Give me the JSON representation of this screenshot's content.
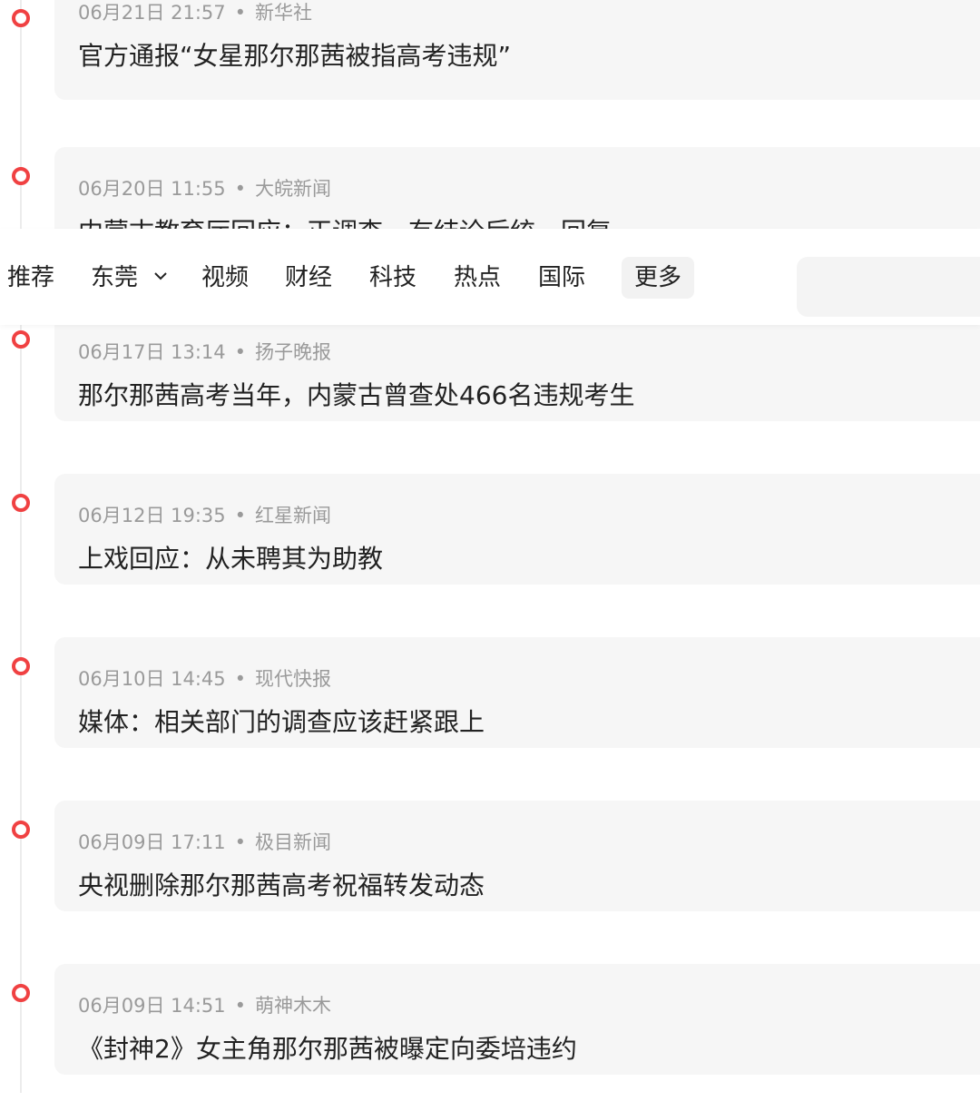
{
  "colors": {
    "accent": "#f04142",
    "card_bg": "#f6f6f6",
    "meta_text": "#9a9a9a",
    "headline_text": "#222222"
  },
  "nav": {
    "tabs": [
      "推荐",
      "东莞",
      "视频",
      "财经",
      "科技",
      "热点",
      "国际"
    ],
    "location_tab_has_dropdown": true,
    "more_label": "更多",
    "search": {
      "value": "",
      "placeholder": ""
    }
  },
  "news": [
    {
      "time": "06月21日 21:57",
      "source": "新华社",
      "title": "官方通报“女星那尔那茜被指高考违规”"
    },
    {
      "time": "06月20日 11:55",
      "source": "大皖新闻",
      "title": "内蒙古教育厅回应：正调查，有结论后统一回复"
    },
    {
      "time": "06月17日 13:14",
      "source": "扬子晚报",
      "title": "那尔那茜高考当年，内蒙古曾查处466名违规考生"
    },
    {
      "time": "06月12日 19:35",
      "source": "红星新闻",
      "title": "上戏回应：从未聘其为助教"
    },
    {
      "time": "06月10日 14:45",
      "source": "现代快报",
      "title": "媒体：相关部门的调查应该赶紧跟上"
    },
    {
      "time": "06月09日 17:11",
      "source": "极目新闻",
      "title": "央视删除那尔那茜高考祝福转发动态"
    },
    {
      "time": "06月09日 14:51",
      "source": "萌神木木",
      "title": "《封神2》女主角那尔那茜被曝定向委培违约"
    }
  ],
  "separator": "•"
}
